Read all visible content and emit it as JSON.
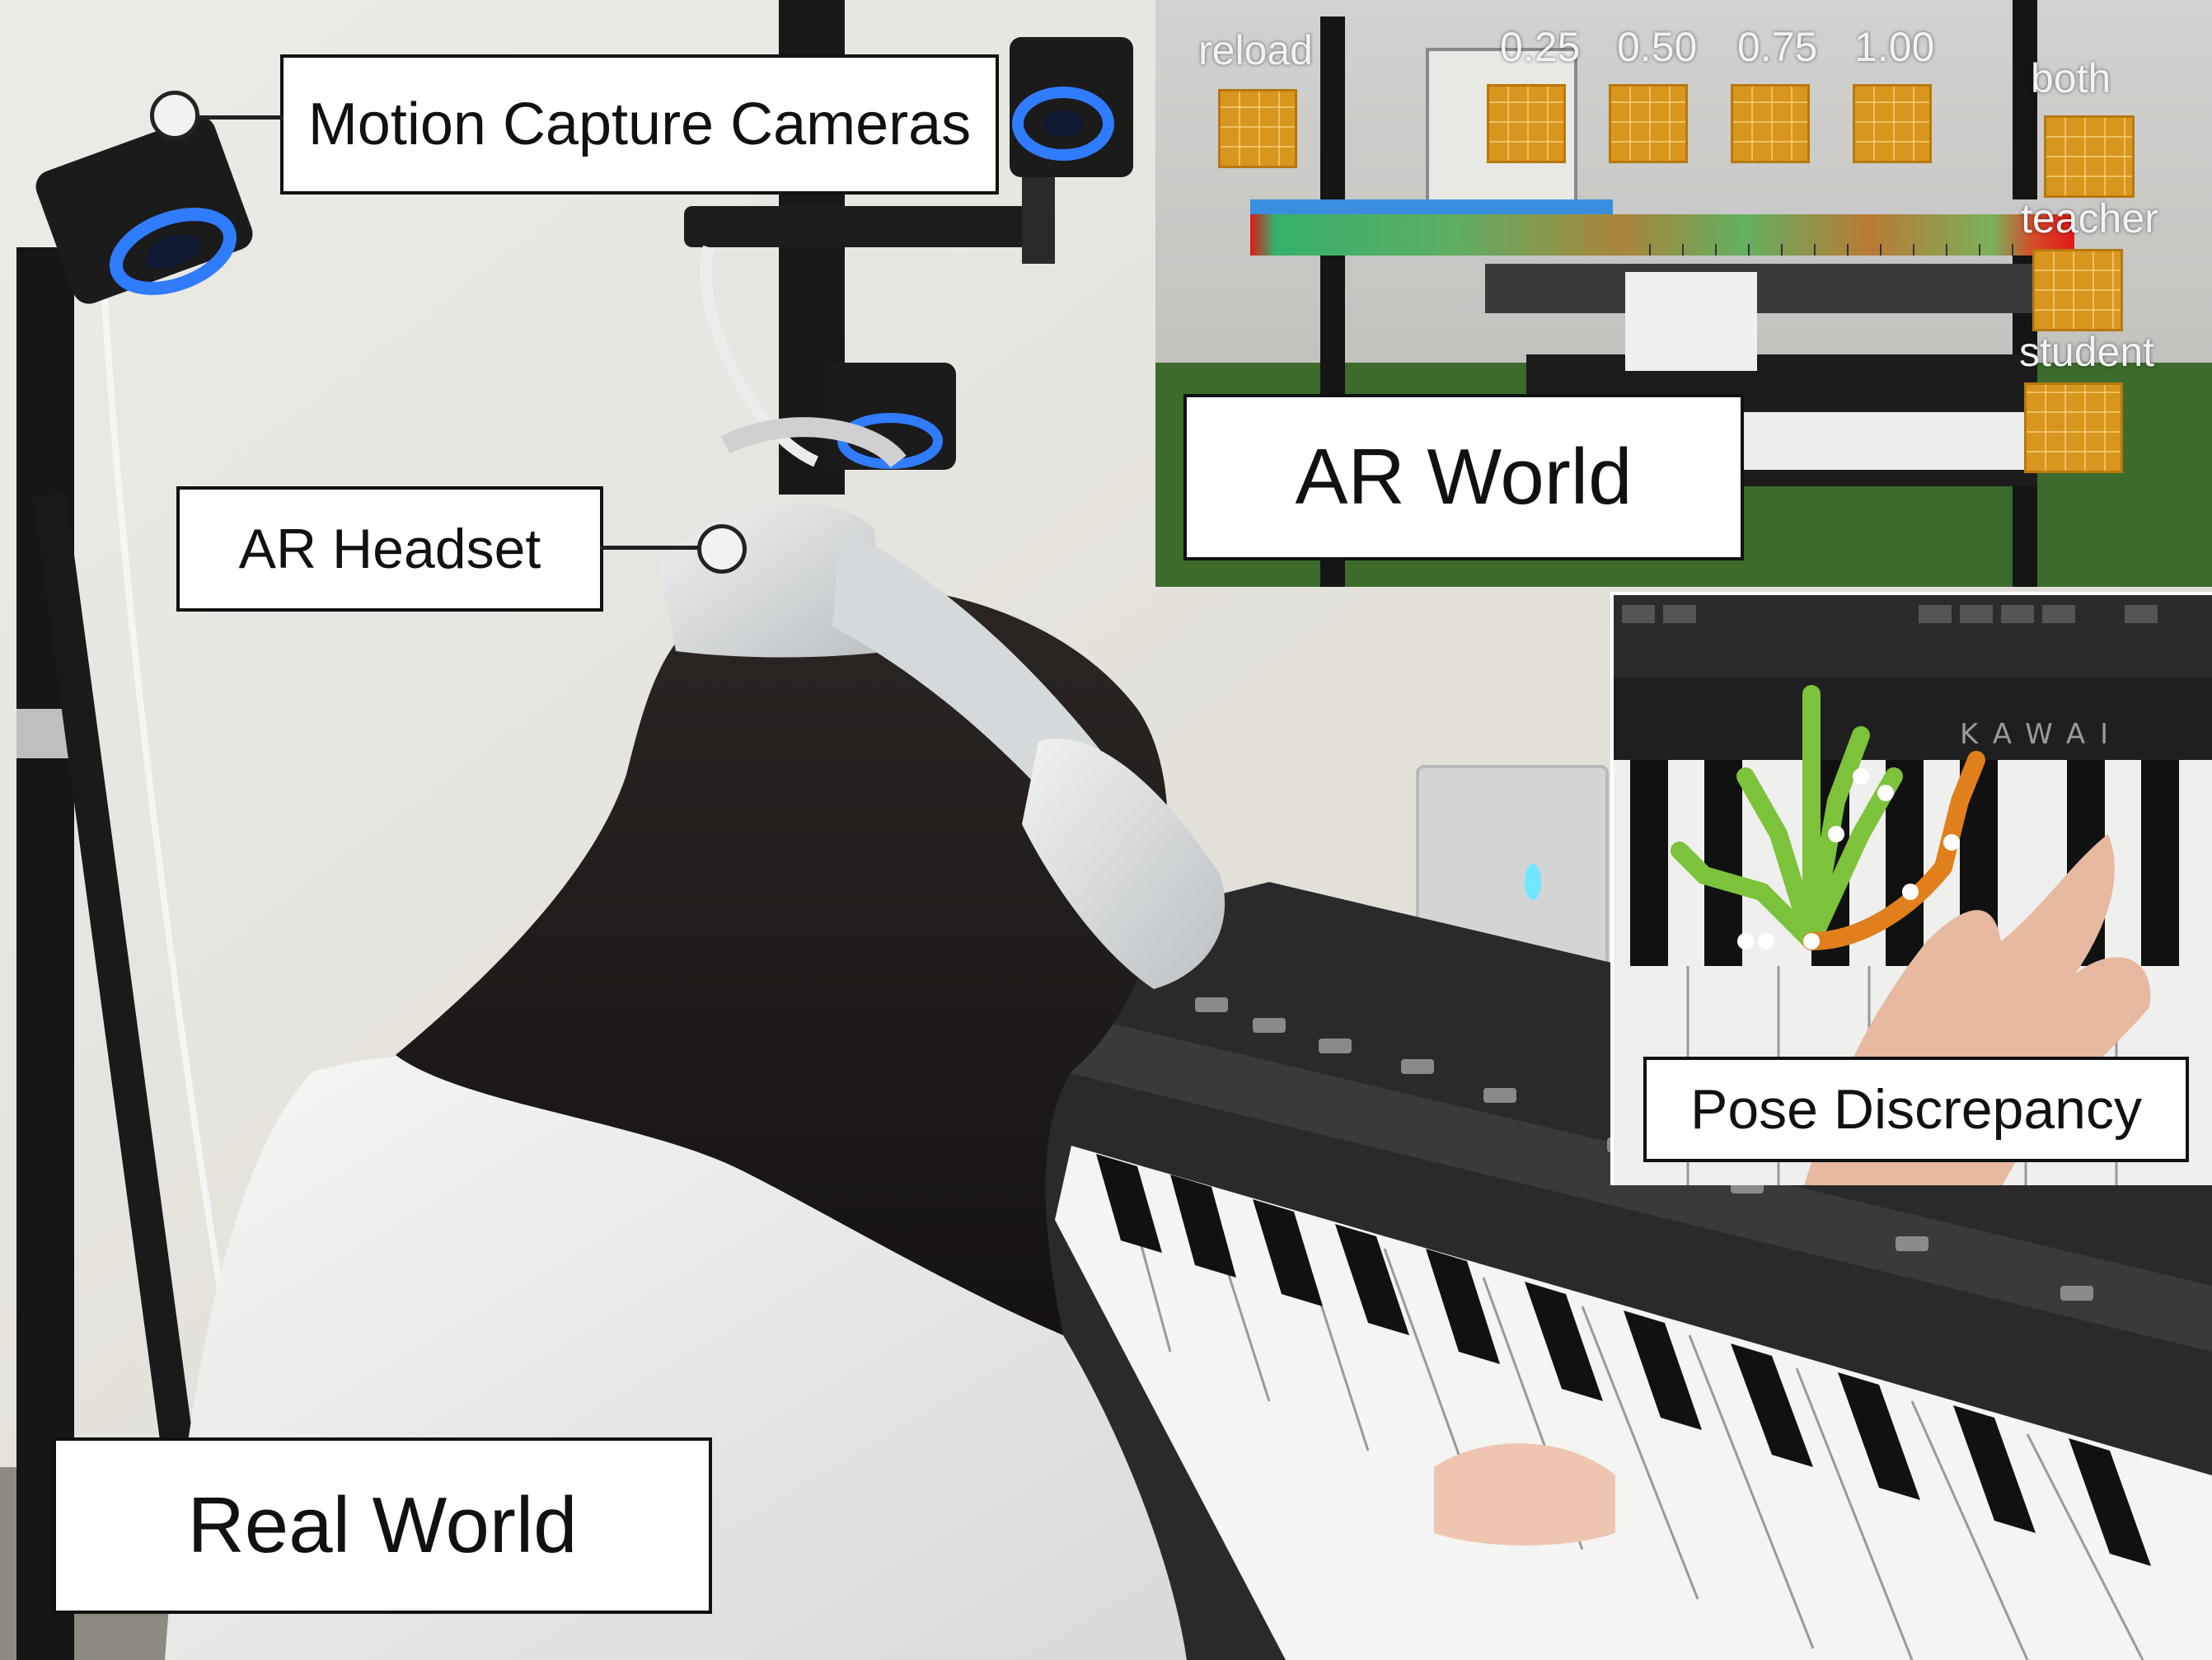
{
  "labels": {
    "motion_capture": "Motion Capture Cameras",
    "ar_headset": "AR Headset",
    "real_world": "Real World",
    "ar_world": "AR World",
    "pose_discrepancy": "Pose Discrepancy"
  },
  "ar_ui": {
    "reload": "reload",
    "speeds": [
      "0.25",
      "0.50",
      "0.75",
      "1.00"
    ],
    "both": "both",
    "teacher": "teacher",
    "student": "student"
  },
  "keyboard_brand": "KAWAI",
  "colors": {
    "ar_button": "#d8961e",
    "camera_ring": "#2f7cff",
    "timeline_blue": "#3a8ee0",
    "timeline_red": "#e01818",
    "timeline_green": "#35b06a",
    "hand_model_green": "#7cc23a",
    "hand_model_orange": "#e07f1c"
  }
}
